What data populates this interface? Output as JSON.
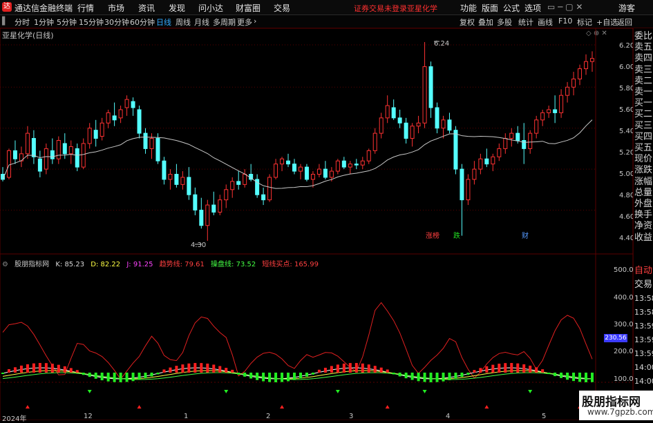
{
  "topbar": {
    "app_title": "通达信金融终端",
    "menu": [
      "行情",
      "市场",
      "资讯",
      "发现",
      "问小达",
      "财富圈",
      "交易"
    ],
    "notice": "证券交易未登录",
    "stock": "亚星化学",
    "right_menu": [
      "功能",
      "版面",
      "公式",
      "选项"
    ],
    "user": "游客"
  },
  "periodbar": {
    "periods": [
      "分时",
      "1分钟",
      "5分钟",
      "15分钟",
      "30分钟",
      "60分钟",
      "日线",
      "周线",
      "月线",
      "多周期",
      "更多"
    ],
    "active": "日线",
    "right": [
      "复权",
      "叠加",
      "多股",
      "统计",
      "画线",
      "F10",
      "标记",
      "+自选",
      "返回"
    ]
  },
  "chart_title": "亚星化学(日线)",
  "price_axis": {
    "ticks": [
      "6.20",
      "6.00",
      "5.80",
      "5.60",
      "5.40",
      "5.20",
      "5.00",
      "4.80",
      "4.60",
      "4.40"
    ],
    "low_label": "4.30",
    "high_label": "6.24"
  },
  "events": [
    {
      "label": "涨榜",
      "color": "#ff4040"
    },
    {
      "label": "跌",
      "color": "#22dd22"
    },
    {
      "label": "财",
      "color": "#5599ff"
    }
  ],
  "indicator": {
    "name": "股朋指标网",
    "items": [
      {
        "label": "K: 85.23",
        "color": "#d8d8d8"
      },
      {
        "label": "D: 82.22",
        "color": "#ffff44"
      },
      {
        "label": "J: 91.25",
        "color": "#ff44ff"
      },
      {
        "label": "趋势线: 79.61",
        "color": "#ff4040"
      },
      {
        "label": "操盘线: 73.52",
        "color": "#44ff44"
      },
      {
        "label": "短线买点: 165.99",
        "color": "#ff4040"
      }
    ],
    "axis": [
      "500.0",
      "400.0",
      "300.0",
      "200.0",
      "100.0"
    ],
    "current_value": "230.56"
  },
  "sidebar_quote": [
    "委比",
    "卖五",
    "卖四",
    "卖三",
    "卖二",
    "卖一",
    "买一",
    "买二",
    "买三",
    "买四",
    "买五",
    "现价",
    "涨跌",
    "涨幅",
    "总量",
    "外盘",
    "换手",
    "净资",
    "收益"
  ],
  "sidebar_trade": [
    "自动",
    "交易",
    "13:58",
    "13:58",
    "13:59",
    "13:59",
    "13:59",
    "14:00",
    "14:00"
  ],
  "x_axis": [
    "2024年",
    "12",
    "1",
    "2",
    "3",
    "4",
    "5"
  ],
  "watermark": {
    "title": "股朋指标网",
    "url": "www.7gpzb.com"
  },
  "colors": {
    "up": "#ff3232",
    "down": "#54ffff",
    "ma": "#c8c8c8",
    "grid": "#5a0000"
  },
  "chart_data": {
    "type": "candlestick",
    "title": "亚星化学(日线)",
    "ylim": [
      4.28,
      6.26
    ],
    "ohlc": [
      [
        4.95,
        5.02,
        4.88,
        4.9
      ],
      [
        4.92,
        5.2,
        4.9,
        5.18
      ],
      [
        5.18,
        5.28,
        5.05,
        5.1
      ],
      [
        5.08,
        5.22,
        5.02,
        5.15
      ],
      [
        5.15,
        5.42,
        5.1,
        5.35
      ],
      [
        5.3,
        5.38,
        5.05,
        5.12
      ],
      [
        5.1,
        5.18,
        4.92,
        4.98
      ],
      [
        5.0,
        5.25,
        4.95,
        5.2
      ],
      [
        5.18,
        5.3,
        5.05,
        5.1
      ],
      [
        5.1,
        5.32,
        5.05,
        5.28
      ],
      [
        5.25,
        5.35,
        5.1,
        5.15
      ],
      [
        5.15,
        5.28,
        5.05,
        5.22
      ],
      [
        5.2,
        5.25,
        4.98,
        5.02
      ],
      [
        5.02,
        5.3,
        5.0,
        5.25
      ],
      [
        5.25,
        5.45,
        5.2,
        5.4
      ],
      [
        5.38,
        5.48,
        5.22,
        5.3
      ],
      [
        5.32,
        5.5,
        5.28,
        5.45
      ],
      [
        5.45,
        5.58,
        5.4,
        5.55
      ],
      [
        5.52,
        5.65,
        5.42,
        5.48
      ],
      [
        5.5,
        5.62,
        5.45,
        5.58
      ],
      [
        5.6,
        5.72,
        5.52,
        5.68
      ],
      [
        5.66,
        5.7,
        5.52,
        5.6
      ],
      [
        5.58,
        5.62,
        5.3,
        5.35
      ],
      [
        5.35,
        5.4,
        5.15,
        5.2
      ],
      [
        5.2,
        5.35,
        5.1,
        5.3
      ],
      [
        5.3,
        5.35,
        5.05,
        5.08
      ],
      [
        5.08,
        5.12,
        4.85,
        4.9
      ],
      [
        4.9,
        5.0,
        4.8,
        4.95
      ],
      [
        4.95,
        5.05,
        4.82,
        4.85
      ],
      [
        4.85,
        4.98,
        4.8,
        4.92
      ],
      [
        4.92,
        5.02,
        4.7,
        4.75
      ],
      [
        4.75,
        4.82,
        4.55,
        4.6
      ],
      [
        4.6,
        4.72,
        4.42,
        4.45
      ],
      [
        4.45,
        4.7,
        4.3,
        4.65
      ],
      [
        4.65,
        4.78,
        4.55,
        4.58
      ],
      [
        4.58,
        4.75,
        4.55,
        4.7
      ],
      [
        4.7,
        4.85,
        4.62,
        4.8
      ],
      [
        4.8,
        4.92,
        4.72,
        4.88
      ],
      [
        4.88,
        4.98,
        4.8,
        4.85
      ],
      [
        4.85,
        5.0,
        4.82,
        4.95
      ],
      [
        4.95,
        5.05,
        4.88,
        4.9
      ],
      [
        4.9,
        4.95,
        4.72,
        4.75
      ],
      [
        4.75,
        4.82,
        4.65,
        4.7
      ],
      [
        4.7,
        4.95,
        4.68,
        4.92
      ],
      [
        4.92,
        5.1,
        4.9,
        5.05
      ],
      [
        5.05,
        5.12,
        4.98,
        5.1
      ],
      [
        5.08,
        5.15,
        5.02,
        5.05
      ],
      [
        5.05,
        5.1,
        4.95,
        4.98
      ],
      [
        4.98,
        5.05,
        4.9,
        5.02
      ],
      [
        5.02,
        5.05,
        4.88,
        4.9
      ],
      [
        4.9,
        4.98,
        4.82,
        4.95
      ],
      [
        4.95,
        5.05,
        4.92,
        5.0
      ],
      [
        5.0,
        5.08,
        4.9,
        4.92
      ],
      [
        4.92,
        5.02,
        4.88,
        4.98
      ],
      [
        4.98,
        5.1,
        4.95,
        5.08
      ],
      [
        5.08,
        5.12,
        5.0,
        5.02
      ],
      [
        5.02,
        5.08,
        4.95,
        5.05
      ],
      [
        5.05,
        5.1,
        5.0,
        5.04
      ],
      [
        5.04,
        5.12,
        5.0,
        5.08
      ],
      [
        5.08,
        5.2,
        5.05,
        5.18
      ],
      [
        5.18,
        5.4,
        5.15,
        5.35
      ],
      [
        5.35,
        5.55,
        5.3,
        5.5
      ],
      [
        5.5,
        5.72,
        5.45,
        5.62
      ],
      [
        5.6,
        5.68,
        5.48,
        5.5
      ],
      [
        5.5,
        5.58,
        5.4,
        5.45
      ],
      [
        5.45,
        5.5,
        5.25,
        5.3
      ],
      [
        5.3,
        5.45,
        5.22,
        5.42
      ],
      [
        5.42,
        5.52,
        5.35,
        5.45
      ],
      [
        5.45,
        6.24,
        5.4,
        6.0
      ],
      [
        6.0,
        6.05,
        5.5,
        5.6
      ],
      [
        5.6,
        5.65,
        5.35,
        5.4
      ],
      [
        5.4,
        5.52,
        5.3,
        5.48
      ],
      [
        5.48,
        5.55,
        5.35,
        5.38
      ],
      [
        5.38,
        5.42,
        4.95,
        5.0
      ],
      [
        5.0,
        5.05,
        4.35,
        4.7
      ],
      [
        4.7,
        4.95,
        4.65,
        4.9
      ],
      [
        4.9,
        5.08,
        4.85,
        5.0
      ],
      [
        5.0,
        5.15,
        4.95,
        5.1
      ],
      [
        5.1,
        5.2,
        5.02,
        5.05
      ],
      [
        5.05,
        5.15,
        4.98,
        5.12
      ],
      [
        5.12,
        5.25,
        5.08,
        5.2
      ],
      [
        5.2,
        5.35,
        5.15,
        5.3
      ],
      [
        5.3,
        5.4,
        5.22,
        5.35
      ],
      [
        5.35,
        5.42,
        5.25,
        5.28
      ],
      [
        5.28,
        5.45,
        5.05,
        5.2
      ],
      [
        5.2,
        5.38,
        5.15,
        5.35
      ],
      [
        5.35,
        5.52,
        5.3,
        5.48
      ],
      [
        5.48,
        5.58,
        5.42,
        5.55
      ],
      [
        5.55,
        5.62,
        5.5,
        5.58
      ],
      [
        5.58,
        5.72,
        5.45,
        5.55
      ],
      [
        5.55,
        5.78,
        5.5,
        5.72
      ],
      [
        5.72,
        5.85,
        5.65,
        5.8
      ],
      [
        5.8,
        5.95,
        5.72,
        5.88
      ],
      [
        5.88,
        6.02,
        5.82,
        5.98
      ],
      [
        5.98,
        6.12,
        5.92,
        6.05
      ],
      [
        6.05,
        6.15,
        5.95,
        6.08
      ]
    ],
    "ma_line": "20-period moving average (white)",
    "events_at": [
      63,
      70,
      78
    ]
  }
}
